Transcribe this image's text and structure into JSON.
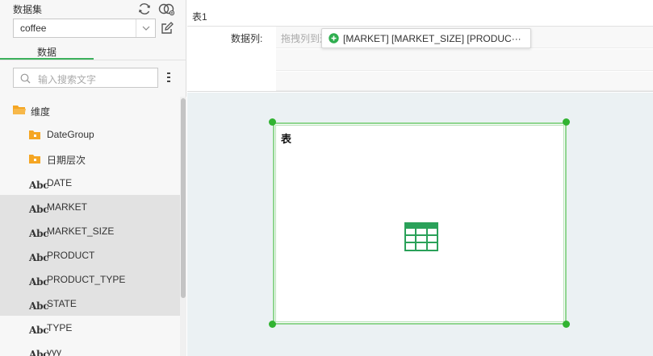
{
  "left_panel": {
    "dataset_label": "数据集",
    "dataset_value": "coffee",
    "tab_label": "数据",
    "search_placeholder": "输入搜索文字",
    "tree": [
      {
        "label": "维度",
        "type": "folder-open",
        "selected": false
      },
      {
        "label": "DateGroup",
        "type": "folder",
        "selected": false
      },
      {
        "label": "日期层次",
        "type": "folder",
        "selected": false
      },
      {
        "label": "DATE",
        "type": "abc",
        "selected": false
      },
      {
        "label": "MARKET",
        "type": "abc",
        "selected": true
      },
      {
        "label": "MARKET_SIZE",
        "type": "abc",
        "selected": true
      },
      {
        "label": "PRODUCT",
        "type": "abc",
        "selected": true
      },
      {
        "label": "PRODUCT_TYPE",
        "type": "abc",
        "selected": true
      },
      {
        "label": "STATE",
        "type": "abc",
        "selected": true
      },
      {
        "label": "TYPE",
        "type": "abc",
        "selected": false
      },
      {
        "label": "yyy",
        "type": "abc",
        "selected": false
      }
    ],
    "abc_badge": "Abc"
  },
  "right_panel": {
    "sheet_tab": "表1",
    "data_col_label": "数据列:",
    "drop_hint": "拖拽列到这",
    "drag_chip": "[MARKET] [MARKET_SIZE] [PRODUC···"
  },
  "widget": {
    "title": "表"
  },
  "colors": {
    "accent_green": "#3cb15c",
    "folder_orange": "#f5a623",
    "selection_bg": "#e2e2e2",
    "canvas_bg": "#ebf1f3"
  }
}
